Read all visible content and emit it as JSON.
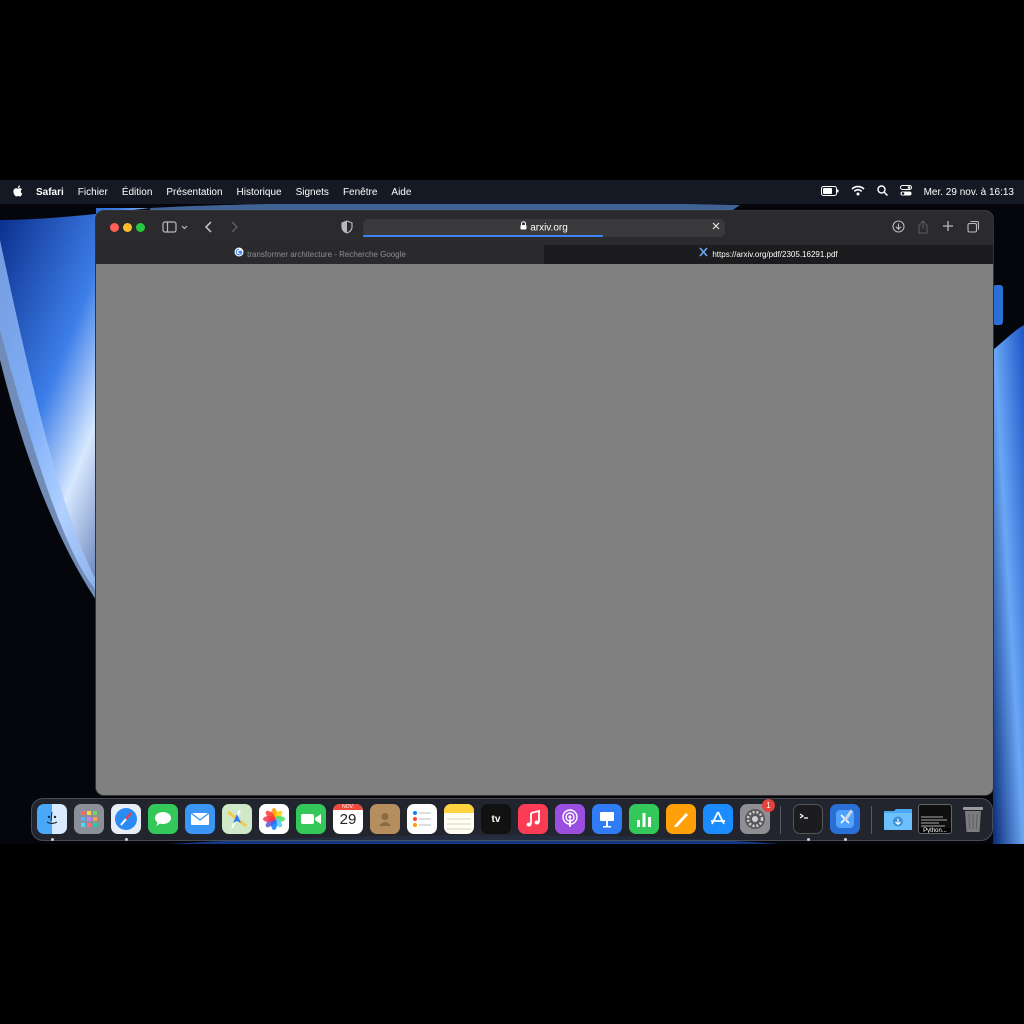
{
  "menubar": {
    "app_name": "Safari",
    "menus": [
      "Fichier",
      "Édition",
      "Présentation",
      "Historique",
      "Signets",
      "Fenêtre",
      "Aide"
    ],
    "clock": "Mer. 29 nov. à 16:13"
  },
  "browser": {
    "address": "arxiv.org",
    "tabs": [
      {
        "title": "transformer architecture - Recherche Google",
        "active": false
      },
      {
        "title": "https://arxiv.org/pdf/2305.16291.pdf",
        "active": true
      }
    ]
  },
  "dock": {
    "apps": [
      "finder",
      "launchpad",
      "safari",
      "messages",
      "mail",
      "maps",
      "photos",
      "facetime",
      "calendar",
      "contacts",
      "reminders",
      "notes",
      "apple-tv",
      "music",
      "podcasts",
      "keynote",
      "numbers",
      "pages",
      "app-store",
      "system-settings",
      "terminal",
      "xcode"
    ],
    "calendar_month": "NOV.",
    "calendar_day": "29",
    "tv_label": "tv",
    "settings_badge": "1",
    "python_label": "Python..."
  },
  "colors": {
    "accent": "#3d85f5",
    "content_bg": "#808080",
    "toolbar_bg": "#2b2b2d",
    "badge": "#e5413d"
  }
}
